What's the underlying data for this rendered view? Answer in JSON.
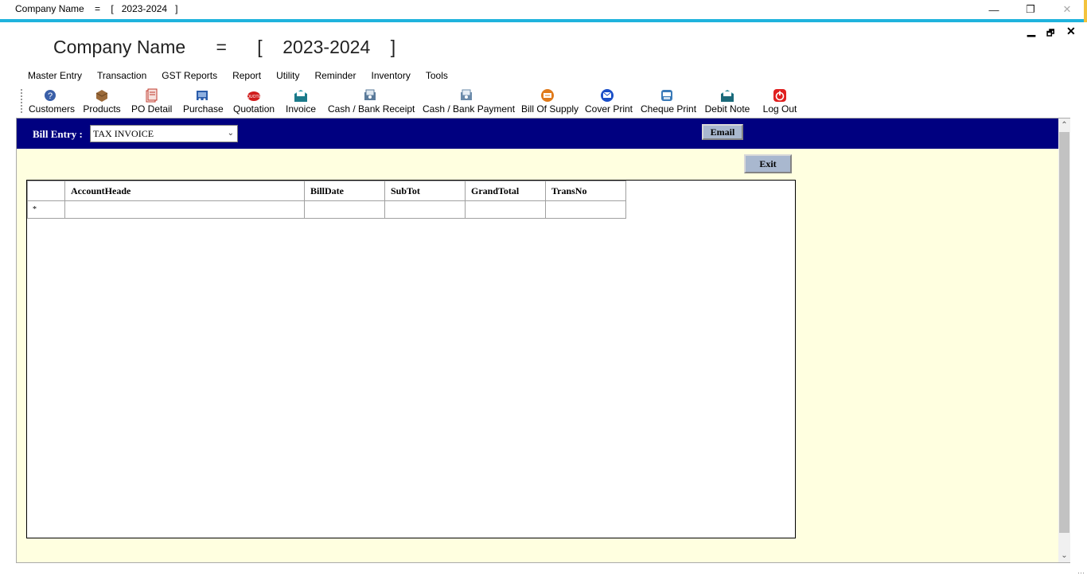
{
  "window": {
    "title": "Company Name    =    [   2023-2024   ]",
    "min": "—",
    "max": "❐",
    "close": "✕"
  },
  "mdi": {
    "min": "▁",
    "restore": "🗗",
    "close": "✕"
  },
  "header": {
    "title": "Company Name      =      [    2023-2024    ]"
  },
  "menu": [
    "Master Entry",
    "Transaction",
    "GST Reports",
    "Report",
    "Utility",
    "Reminder",
    "Inventory",
    "Tools"
  ],
  "toolbar": [
    {
      "label": "Customers",
      "icon": "customers-icon",
      "color": "#3a5fa8"
    },
    {
      "label": "Products",
      "icon": "products-icon",
      "color": "#9b6a3a"
    },
    {
      "label": "PO Detail",
      "icon": "po-detail-icon",
      "color": "#c0392b"
    },
    {
      "label": "Purchase",
      "icon": "purchase-icon",
      "color": "#2a5caa"
    },
    {
      "label": "Quotation",
      "icon": "quotation-icon",
      "color": "#d01c1c"
    },
    {
      "label": "Invoice",
      "icon": "invoice-icon",
      "color": "#1b7a8a"
    },
    {
      "label": "Cash / Bank Receipt",
      "icon": "receipt-icon",
      "color": "#5a7a9a"
    },
    {
      "label": "Cash / Bank Payment",
      "icon": "payment-icon",
      "color": "#6a8aaa"
    },
    {
      "label": "Bill Of Supply",
      "icon": "bill-of-supply-icon",
      "color": "#e07a1a"
    },
    {
      "label": "Cover Print",
      "icon": "cover-print-icon",
      "color": "#1a4fc8"
    },
    {
      "label": "Cheque Print",
      "icon": "cheque-print-icon",
      "color": "#3a7ab8"
    },
    {
      "label": "Debit Note",
      "icon": "debit-note-icon",
      "color": "#1b6a7a"
    },
    {
      "label": "Log Out",
      "icon": "power-icon",
      "color": "#e02020"
    }
  ],
  "form": {
    "bill_label": "Bill Entry :",
    "bill_type": "TAX INVOICE",
    "email": "Email",
    "exit": "Exit",
    "header_color": "#000080",
    "background": "#ffffe0"
  },
  "grid": {
    "columns": [
      "",
      "AccountHeade",
      "BillDate",
      "SubTot",
      "GrandTotal",
      "TransNo"
    ],
    "new_row_marker": "*"
  }
}
